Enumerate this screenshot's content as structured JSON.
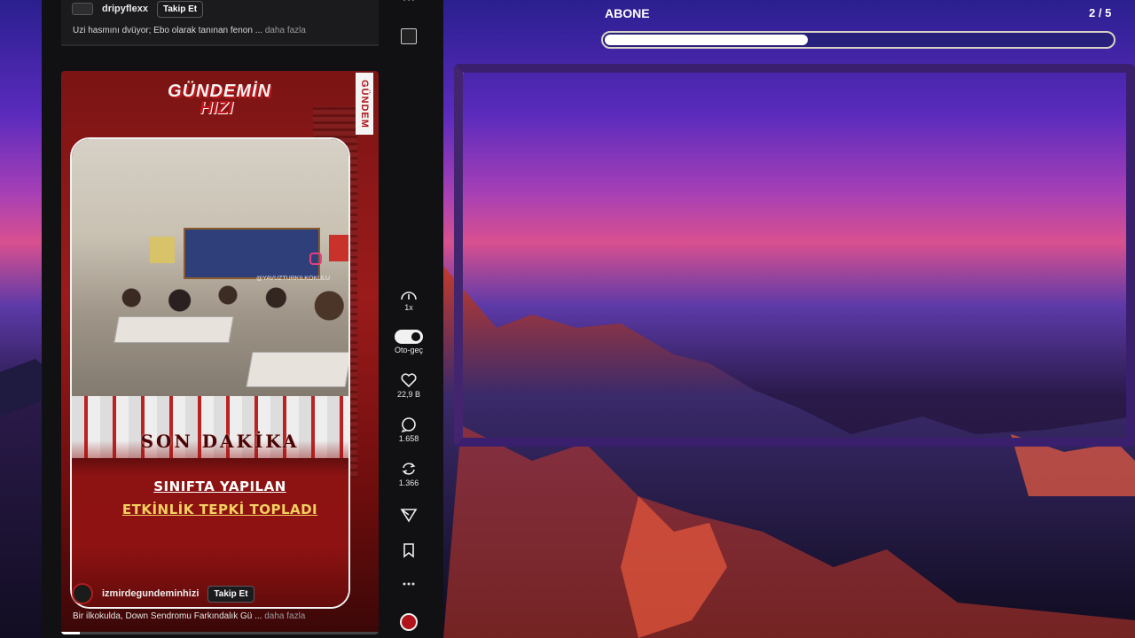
{
  "feed": {
    "top_post": {
      "username": "dripyflexx",
      "follow_label": "Takip Et",
      "caption": "Uzi hasmını dvüyor; Ebo olarak tanınan fenon",
      "caption_ellipsis": "...",
      "more_label": "daha fazla"
    },
    "video_post": {
      "brand_line1": "GÜNDEMİN",
      "brand_line2": "HIZI",
      "vertical_tag": "GÜNDEM",
      "watermark": "@YAVUZTURKILKOKULU",
      "breaking": "SON DAKİKA",
      "headline_line1": "SINIFTA YAPILAN",
      "headline_line2": "ETKİNLİK TEPKİ TOPLADI",
      "username": "izmirdegundeminhizi",
      "follow_label": "Takip Et",
      "caption": "Bir ilkokulda, Down Sendromu Farkındalık Gü",
      "caption_ellipsis": "...",
      "more_label": "daha fazla",
      "progress": 0.06
    }
  },
  "rail": {
    "speed_label": "1x",
    "autoplay_label": "Oto-geç",
    "likes": "22,9 B",
    "comments": "1.658",
    "reposts": "1.366",
    "more_glyph": "..."
  },
  "overlay": {
    "title": "ABONE",
    "counter": "2 / 5",
    "bar_progress": 0.4,
    "colors": {
      "bar_border": "#d8d3c4",
      "frame": "#3a1f6e",
      "cyan_accent": "#28d3f0"
    }
  }
}
